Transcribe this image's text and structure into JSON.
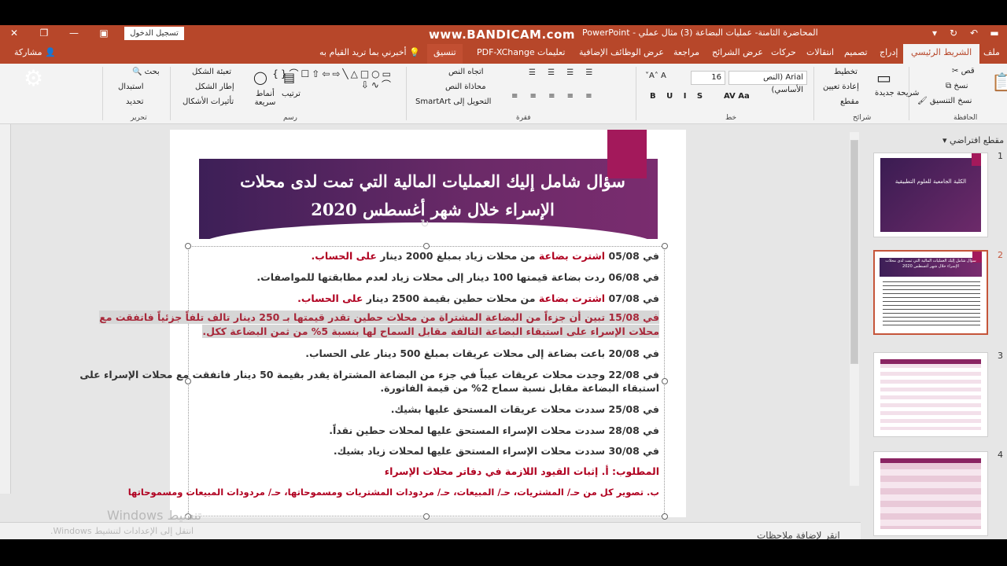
{
  "titlebar": {
    "doc_title": "المحاضرة الثامنة- عمليات البضاعة (3) مثال عملي  -  PowerPoint",
    "watermark": "www.BANDICAM.com",
    "signin": "تسجيل الدخول"
  },
  "tabs": [
    {
      "label": "ملف"
    },
    {
      "label": "الشريط الرئيسي"
    },
    {
      "label": "إدراج"
    },
    {
      "label": "تصميم"
    },
    {
      "label": "انتقالات"
    },
    {
      "label": "حركات"
    },
    {
      "label": "عرض الشرائح"
    },
    {
      "label": "مراجعة"
    },
    {
      "label": "عرض"
    },
    {
      "label": "الوظائف الإضافية"
    },
    {
      "label": "تعليمات"
    },
    {
      "label": "PDF-XChange"
    },
    {
      "label": "تنسيق"
    }
  ],
  "tell_me": "أخبرني بما تريد القيام به",
  "share": "مشاركة",
  "ribbon": {
    "clipboard": {
      "cut": "قص",
      "copy": "نسخ",
      "format_painter": "نسخ التنسيق",
      "label": "الحافظة"
    },
    "slides": {
      "new_slide": "شريحة جديدة",
      "layout": "تخطيط",
      "reset": "إعادة تعيين",
      "section": "مقطع",
      "label": "شرائح"
    },
    "font": {
      "name": "Arial (النص الأساسي)",
      "size": "16",
      "label": "خط"
    },
    "paragraph": {
      "direction": "اتجاه النص",
      "align": "محاذاة النص",
      "smartart": "التحويل إلى SmartArt",
      "label": "فقرة"
    },
    "drawing": {
      "arrange": "ترتيب",
      "quick_styles": "أنماط سريعة",
      "fill": "تعبئة الشكل",
      "outline": "إطار الشكل",
      "effects": "تأثيرات الأشكال",
      "label": "رسم"
    },
    "editing": {
      "find": "بحث",
      "replace": "استبدال",
      "select": "تحديد",
      "label": "تحرير"
    }
  },
  "slide": {
    "title_line1": "سؤال شامل إليك العمليات المالية التي تمت لدى محلات",
    "title_line2": "الإسراء خلال شهر أغسطس 2020",
    "paras": [
      {
        "a": "في 05/08 ",
        "b": "اشترت بضاعة",
        "c": " من محلات زياد بمبلغ 2000 دينار ",
        "d": "على الحساب."
      },
      {
        "a": "في 06/08 ردت بضاعة قيمتها 100 دينار إلى محلات زياد لعدم مطابقتها للمواصفات.",
        "b": "",
        "c": "",
        "d": ""
      },
      {
        "a": "في 07/08 ",
        "b": "اشترت بضاعة",
        "c": " من محلات حطين بقيمة 2500 دينار ",
        "d": "على الحساب."
      },
      {
        "a": "في 15/08 تبين أن جزءاً من البضاعة المشتراة من محلات حطين تقدر قيمتها بـ 250 دينار تالف تلفاً جزئياً فاتفقت مع",
        "b": "",
        "c": "",
        "d": ""
      },
      {
        "a": "محلات الإسراء على استبقاء البضاعة التالفة مقابل السماح لها بنسبة 5% من ثمن البضاعة ككل.",
        "b": "",
        "c": "",
        "d": ""
      },
      {
        "a": "في 20/08 باعت بضاعة إلى محلات عريقات بمبلغ 500 دينار على الحساب.",
        "b": "",
        "c": "",
        "d": ""
      },
      {
        "a": "في 22/08 وجدت محلات عريقات عيباً في جزء من البضاعة المشتراة يقدر بقيمة 50 دينار فاتفقت مع محلات الإسراء على",
        "b": "",
        "c": "",
        "d": ""
      },
      {
        "a": "استبقاء البضاعة مقابل نسبة سماح 2% من قيمة الفاتورة.",
        "b": "",
        "c": "",
        "d": ""
      },
      {
        "a": "في 25/08 سددت محلات عريقات المستحق عليها بشيك.",
        "b": "",
        "c": "",
        "d": ""
      },
      {
        "a": "في 28/08 سددت محلات الإسراء المستحق عليها لمحلات حطين نقداً.",
        "b": "",
        "c": "",
        "d": ""
      },
      {
        "a": "في 30/08 سددت محلات الإسراء المستحق عليها لمحلات زياد بشيك.",
        "b": "",
        "c": "",
        "d": ""
      }
    ],
    "required": "المطلوب: أ. إثبات القيود اللازمة في دفاتر محلات الإسراء",
    "required_b": "ب. تصوير كل من حـ/ المشتريات، حـ/ المبيعات، حـ/ مردودات المشتريات ومسموحاتها، حـ/ مردودات المبيعات ومسموحاتها"
  },
  "thumbs": {
    "section": "مقطع افتراضي",
    "items": [
      {
        "num": "1",
        "title": "الكلية الجامعية للعلوم التطبيقية"
      },
      {
        "num": "2",
        "title": "سؤال شامل إليك العمليات المالية التي تمت لدى محلات الإسراء خلال شهر أغسطس 2020"
      },
      {
        "num": "3",
        "title": ""
      },
      {
        "num": "4",
        "title": ""
      }
    ]
  },
  "notes_label": "انقر لإضافة ملاحظات",
  "windows_activate": "تنشيط Windows",
  "windows_activate_sub": "انتقل إلى الإعدادات لتنشيط Windows."
}
